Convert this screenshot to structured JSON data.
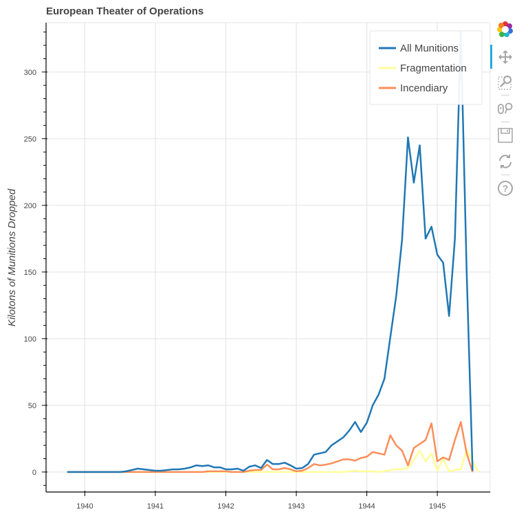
{
  "chart_data": {
    "type": "line",
    "title": "European Theater of Operations",
    "xlabel": "",
    "ylabel": "Kilotons of Munitions Dropped",
    "xlim": [
      1939.45,
      1945.75
    ],
    "ylim": [
      -15,
      337
    ],
    "x_ticks": [
      1940,
      1941,
      1942,
      1943,
      1944,
      1945
    ],
    "x_tick_labels": [
      "1940",
      "1941",
      "1942",
      "1943",
      "1944",
      "1945"
    ],
    "y_ticks": [
      0,
      50,
      100,
      150,
      200,
      250,
      300
    ],
    "y_tick_labels": [
      "0",
      "50",
      "100",
      "150",
      "200",
      "250",
      "300"
    ],
    "y_minor_step": 10,
    "grid": true,
    "legend_position": "top-right",
    "x_start": 1939.75,
    "x_step_months": 1,
    "series": [
      {
        "name": "All Munitions",
        "color": "#1f77b4",
        "values": [
          0,
          0,
          0,
          0,
          0,
          0,
          0,
          0,
          0,
          0,
          0.5,
          1.5,
          2.5,
          2,
          1.5,
          1,
          1,
          1.5,
          2,
          2,
          2.5,
          3.5,
          5,
          4.5,
          5,
          3.5,
          3.5,
          2,
          2,
          2.5,
          1,
          4,
          5,
          3,
          9,
          6,
          6,
          7,
          5,
          2.5,
          3,
          6,
          13,
          14,
          15,
          20,
          23,
          26,
          31,
          37.5,
          30,
          37,
          50,
          58,
          70,
          101,
          132,
          174,
          251,
          217,
          245,
          175,
          184,
          163,
          157,
          117,
          175,
          330,
          150,
          1
        ]
      },
      {
        "name": "Fragmentation",
        "color": "#ffff99",
        "values": [
          0,
          0,
          0,
          0,
          0,
          0,
          0,
          0,
          0,
          0,
          0,
          0,
          0,
          0,
          0,
          0,
          0,
          0,
          0,
          0,
          0,
          0,
          0,
          0,
          0,
          0,
          0,
          0,
          0,
          0,
          0,
          0,
          0,
          0,
          0,
          0,
          0,
          0,
          0,
          0,
          0,
          0,
          0,
          0,
          0,
          0,
          0,
          0,
          0.5,
          1,
          0.5,
          0.5,
          0.5,
          0,
          0.5,
          1.5,
          2,
          2,
          3,
          9,
          16,
          8,
          14,
          1,
          10,
          0.5,
          1.5,
          2,
          17,
          8,
          0
        ]
      },
      {
        "name": "Incendiary",
        "color": "#fc8d59",
        "values": [
          0,
          0,
          0,
          0,
          0,
          0,
          0,
          0,
          0,
          0,
          0,
          0,
          0,
          0,
          0,
          0,
          0,
          0,
          0,
          0,
          0,
          0,
          0,
          0,
          0.5,
          0.5,
          0.5,
          0.5,
          0,
          0,
          0,
          1,
          1.5,
          1.5,
          5.5,
          2,
          2,
          3,
          2,
          0.5,
          1,
          3,
          6,
          5,
          5.5,
          6.5,
          8,
          9.5,
          9.5,
          8.5,
          10.5,
          11.5,
          15,
          14,
          13,
          27.5,
          20,
          16,
          5,
          18,
          21,
          24,
          36.5,
          8,
          11,
          9,
          24,
          37.5,
          14,
          0
        ]
      }
    ]
  },
  "legend": {
    "items": [
      "All Munitions",
      "Fragmentation",
      "Incendiary"
    ]
  },
  "toolbar": {
    "tools": [
      {
        "name": "bokeh-logo-icon",
        "label": "Bokeh"
      },
      {
        "name": "pan-icon",
        "label": "Pan",
        "active": true
      },
      {
        "name": "box-zoom-icon",
        "label": "Box Zoom"
      },
      {
        "name": "wheel-zoom-icon",
        "label": "Wheel Zoom"
      },
      {
        "name": "save-icon",
        "label": "Save"
      },
      {
        "name": "reset-icon",
        "label": "Reset"
      },
      {
        "name": "help-icon",
        "label": "Help"
      }
    ],
    "accent_color": "#26aae1"
  }
}
